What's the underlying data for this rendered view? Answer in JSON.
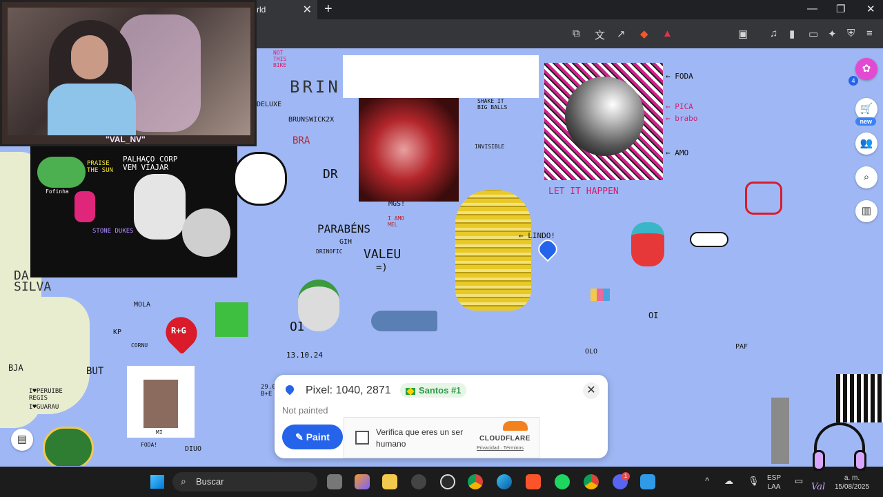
{
  "browser": {
    "tab_title": "rld",
    "tab_close": "✕",
    "new_tab": "+",
    "window_controls": [
      "—",
      "❐",
      "✕"
    ]
  },
  "canvas": {
    "texts": {
      "brin": "BRIN",
      "deluxe": "DELUXE",
      "brunswick": "BRUNSWICK2X",
      "bra": "BRA",
      "dr": "DR",
      "not_this_bike": "NOT THIS BIKE",
      "shake_it": "SHAKE IT BIG BALLS",
      "invisible": "INVISIBLE",
      "mgs": "MGS!",
      "parabens": "PARABÉNS",
      "gih": "GIH",
      "drinofic": "DRINOFIC",
      "amo_mel": "I AMO MEL",
      "valeu": "VALEU",
      "valeu_face": "=)",
      "lindo": "← LINDO!",
      "let_it_happen": "LET IT HAPPEN",
      "foda": "← FODA",
      "pica": "← PICA",
      "brabo": "← brabo",
      "amo": "← AMO",
      "date": "13.10.24",
      "da_silva": "DA SILVA",
      "oi": "OI",
      "mola": "MOLA",
      "kp": "KP",
      "cornu": "CORNU",
      "bja": "BJA",
      "peruibe": "I♥PERUIBE REGIS",
      "guarau": "I♥GUARAU",
      "praise_sun": "PRAISE THE SUN",
      "palhaco": "PALHAÇO CORP VEM VIAJAR",
      "stoned": "STONE DUKES",
      "fogo": "Fofinha",
      "plus_g": "R+G",
      "paf": "PAF",
      "but": "BUT",
      "diuo": "DIUO",
      "foda2": "FODA!",
      "date2": "29.0 B+E",
      "olo": "OLO",
      "ol": "OI",
      "mi": "MI"
    }
  },
  "webcam": {
    "streamer_name": "\"VAL_NV\""
  },
  "sidebar": {
    "notification_count": "4",
    "new_badge": "new",
    "icons": [
      "logo-icon",
      "cart-icon",
      "users-icon",
      "search-zoom-icon",
      "leaderboard-icon"
    ]
  },
  "pixel_panel": {
    "pixel_label": "Pixel: 1040, 2871",
    "country": "Santos #1",
    "status": "Not painted",
    "paint_button": "Paint",
    "close": "✕",
    "captcha_label": "Verifica que eres un ser humano",
    "captcha_brand": "CLOUDFLARE",
    "captcha_links": "Privacidad · Términos"
  },
  "taskbar": {
    "search_placeholder": "Buscar",
    "lang_top": "ESP",
    "lang_bottom": "LAA",
    "time": "a. m.",
    "date": "15/08/2025",
    "discord_badge": "1",
    "signature": "Val"
  },
  "colors": {
    "canvas_bg": "#9fb8f5",
    "accent": "#2563eb",
    "captcha_orange": "#f48120"
  }
}
